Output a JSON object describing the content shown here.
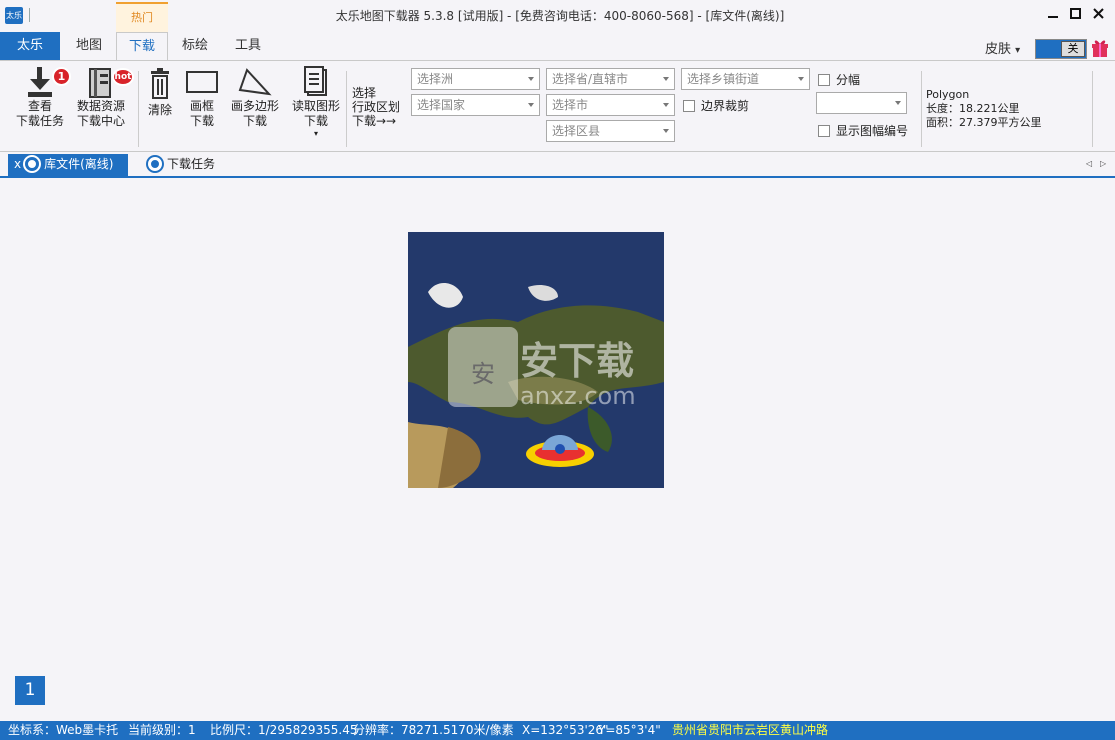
{
  "window": {
    "app_icon_label": "太乐",
    "title": "太乐地图下载器 5.3.8 [试用版] - [免费咨询电话：400-8060-568] - [库文件(离线)]",
    "minimize": "🗕",
    "maximize": "🗖",
    "close": "✕"
  },
  "ribbon_tabs": {
    "hot_label": "热门",
    "file": "太乐",
    "map": "地图",
    "download": "下载",
    "annotate": "标绘",
    "tools": "工具",
    "skin": "皮肤",
    "skin_arrow": "▾",
    "toggle_label": "关"
  },
  "ribbon": {
    "view_tasks": {
      "line1": "查看",
      "line2": "下载任务",
      "badge": "1"
    },
    "data_center": {
      "line1": "数据资源",
      "line2": "下载中心",
      "badge": "hot"
    },
    "clear": {
      "line1": "清除"
    },
    "frame_download": {
      "line1": "画框",
      "line2": "下载"
    },
    "polygon_download": {
      "line1": "画多边形",
      "line2": "下载"
    },
    "read_shape": {
      "line1": "读取图形",
      "line2": "下载",
      "arrow": "▾"
    },
    "admin_select": {
      "line1": "选择",
      "line2": "行政区划",
      "line3": "下载→→"
    },
    "combos": {
      "continent": "选择洲",
      "country": "选择国家",
      "province": "选择省/直辖市",
      "city": "选择市",
      "district": "选择区县",
      "town": "选择乡镇街道",
      "sheet": ""
    },
    "checks": {
      "boundary_clip": "边界裁剪",
      "sheet": "分幅",
      "show_sheet_number": "显示图幅编号"
    },
    "info": {
      "type": "Polygon",
      "length": "长度：18.221公里",
      "area": "面积：27.379平方公里"
    }
  },
  "doc_tabs": {
    "close": "x",
    "library": "库文件(离线)",
    "tasks": "下载任务",
    "prev": "◁",
    "next": "▷"
  },
  "map": {
    "watermark_text": "安下载",
    "watermark_sub": "anxz.com",
    "watermark_badge": "安"
  },
  "page_number": "1",
  "status": {
    "crs": "坐标系：Web墨卡托",
    "level": "当前级别：1",
    "scale": "比例尺：1/295829355.45",
    "resolution": "分辨率：78271.5170米/像素",
    "x": "X=132°53'26\"",
    "y": "Y=85°3'4\"",
    "address": "贵州省贵阳市云岩区黄山冲路"
  },
  "colors": {
    "accent": "#1f6fc1",
    "hot": "#e08820",
    "status_address": "#ffff44"
  }
}
